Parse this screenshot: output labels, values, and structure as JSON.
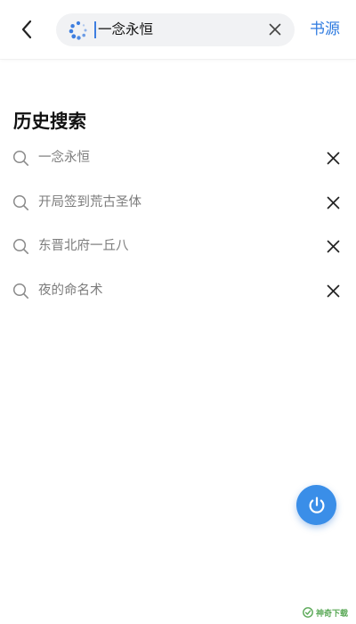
{
  "header": {
    "search": {
      "value": "一念永恒"
    },
    "source_label": "书源"
  },
  "history": {
    "title": "历史搜索",
    "items": [
      {
        "label": "一念永恒"
      },
      {
        "label": "开局签到荒古圣体"
      },
      {
        "label": "东晋北府一丘八"
      },
      {
        "label": "夜的命名术"
      }
    ]
  },
  "watermark": {
    "text": "神奇下载"
  },
  "colors": {
    "accent": "#2f7be0",
    "fab": "#3a8ee8",
    "search_bg": "#f1f2f4",
    "history_text": "#7c7c7c",
    "watermark": "#3e9a3a"
  },
  "icons": {
    "back": "chevron-left-icon",
    "loading": "loading-spinner-icon",
    "clear": "close-icon",
    "history_search": "search-icon",
    "history_remove": "close-icon",
    "fab": "power-icon"
  }
}
